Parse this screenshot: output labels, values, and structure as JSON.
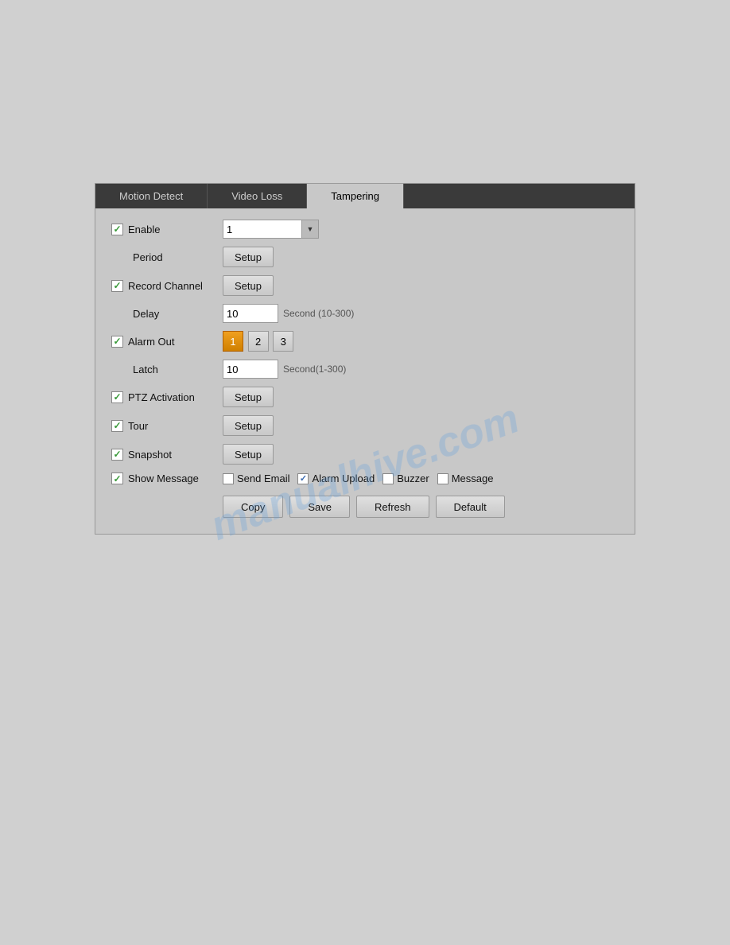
{
  "tabs": [
    {
      "label": "Motion Detect",
      "active": false
    },
    {
      "label": "Video Loss",
      "active": false
    },
    {
      "label": "Tampering",
      "active": true
    }
  ],
  "form": {
    "enable_label": "Enable",
    "enable_checked": true,
    "enable_value": "1",
    "period_label": "Period",
    "period_setup_btn": "Setup",
    "record_channel_label": "Record Channel",
    "record_channel_checked": true,
    "record_channel_btn": "Setup",
    "delay_label": "Delay",
    "delay_value": "10",
    "delay_hint": "Second (10-300)",
    "alarm_out_label": "Alarm Out",
    "alarm_out_checked": true,
    "alarm_btn_1": "1",
    "alarm_btn_2": "2",
    "alarm_btn_3": "3",
    "latch_label": "Latch",
    "latch_value": "10",
    "latch_hint": "Second(1-300)",
    "ptz_activation_label": "PTZ Activation",
    "ptz_activation_checked": true,
    "ptz_activation_btn": "Setup",
    "tour_label": "Tour",
    "tour_checked": true,
    "tour_btn": "Setup",
    "snapshot_label": "Snapshot",
    "snapshot_checked": true,
    "snapshot_btn": "Setup",
    "show_message_label": "Show Message",
    "show_message_checked": true,
    "send_email_label": "Send Email",
    "send_email_checked": false,
    "alarm_upload_label": "Alarm Upload",
    "alarm_upload_checked": true,
    "buzzer_label": "Buzzer",
    "buzzer_checked": false,
    "message_label": "Message",
    "message_checked": false
  },
  "buttons": {
    "copy": "Copy",
    "save": "Save",
    "refresh": "Refresh",
    "default": "Default"
  },
  "watermark": "manualhive.com"
}
